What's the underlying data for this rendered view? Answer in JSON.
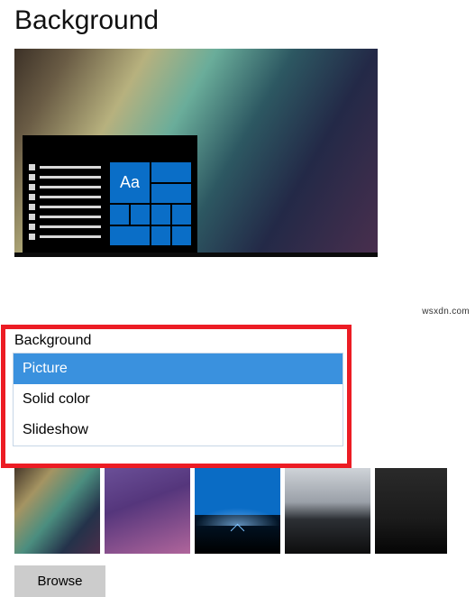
{
  "title": "Background",
  "preview": {
    "tile_text": "Aa"
  },
  "dropdown": {
    "label": "Background",
    "options": [
      "Picture",
      "Solid color",
      "Slideshow"
    ],
    "selected_index": 0
  },
  "browse_label": "Browse",
  "watermark": "wsxdn.com",
  "thumbnails": [
    {
      "name": "wallpaper-gradient"
    },
    {
      "name": "wallpaper-purple"
    },
    {
      "name": "wallpaper-windows-hero"
    },
    {
      "name": "wallpaper-mountain"
    },
    {
      "name": "wallpaper-cliff"
    }
  ]
}
